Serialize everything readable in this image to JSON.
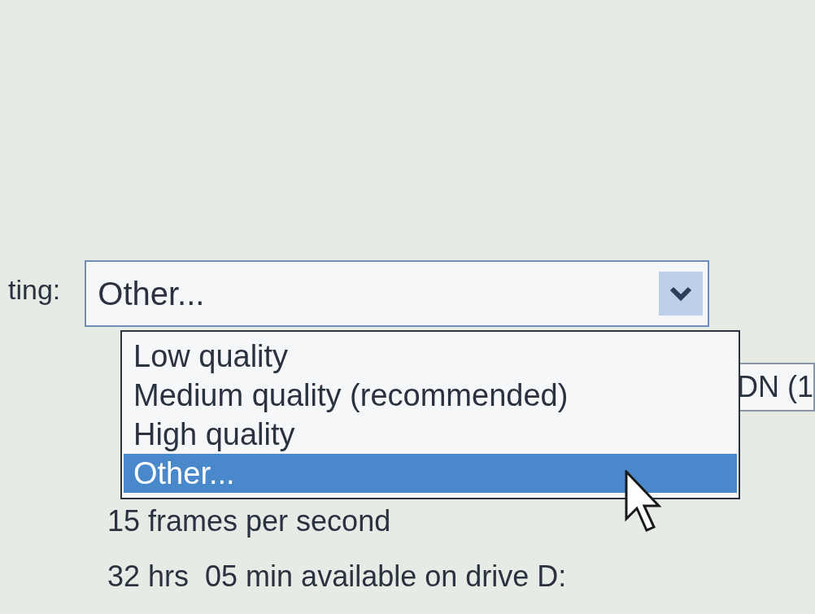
{
  "setting_label": "ting:",
  "combo": {
    "value": "Other...",
    "expanded": true
  },
  "options": [
    {
      "label": "Low quality",
      "selected": false
    },
    {
      "label": "Medium quality (recommended)",
      "selected": false
    },
    {
      "label": "High quality",
      "selected": false
    },
    {
      "label": "Other...",
      "selected": true
    }
  ],
  "side_field": "DN (1",
  "frame_rate": "15 frames per second",
  "disk_space": "32 hrs  05 min available on drive D:"
}
